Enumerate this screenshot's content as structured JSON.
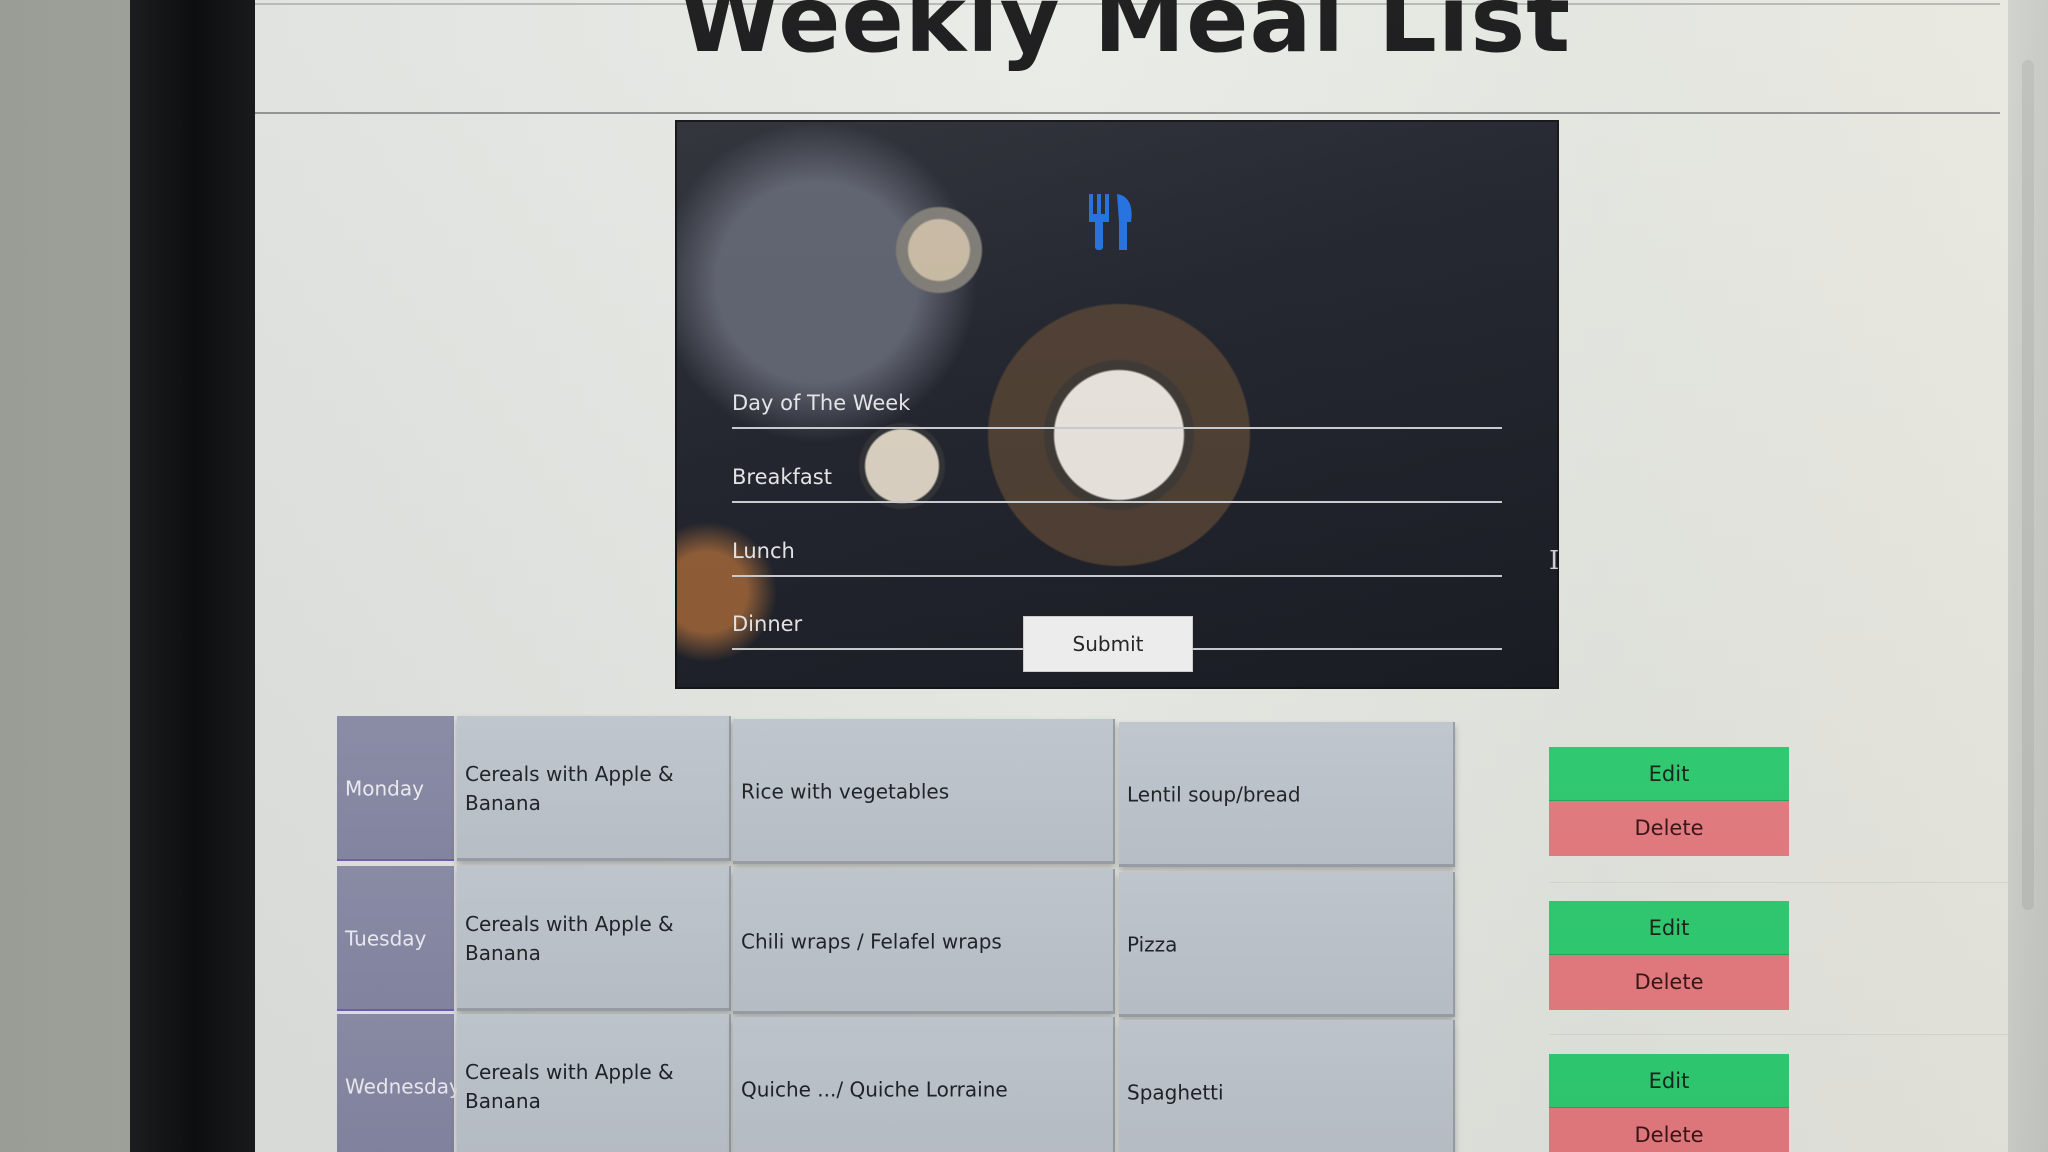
{
  "page": {
    "title": "Weekly Meal List"
  },
  "form": {
    "fields": [
      {
        "placeholder": "Day of The Week"
      },
      {
        "placeholder": "Breakfast"
      },
      {
        "placeholder": "Lunch"
      },
      {
        "placeholder": "Dinner"
      }
    ],
    "submit_label": "Submit",
    "icon": "utensils-icon"
  },
  "meals": {
    "rows": [
      {
        "day": "Monday",
        "breakfast": "Cereals with Apple & Banana",
        "lunch": "Rice with vegetables",
        "dinner": "Lentil soup/bread",
        "edit_label": "Edit",
        "delete_label": "Delete"
      },
      {
        "day": "Tuesday",
        "breakfast": "Cereals with Apple & Banana",
        "lunch": "Chili wraps / Felafel wraps",
        "dinner": "Pizza",
        "edit_label": "Edit",
        "delete_label": "Delete"
      },
      {
        "day": "Wednesday",
        "breakfast": "Cereals with Apple & Banana",
        "lunch": "Quiche .../ Quiche Lorraine",
        "dinner": "Spaghetti",
        "edit_label": "Edit",
        "delete_label": "Delete"
      }
    ]
  },
  "colors": {
    "edit": "#2ecc71",
    "delete": "#e57b80",
    "day_cell": "#8c8ea9",
    "meal_cell": "#c4cad2",
    "icon": "#1e6fe0"
  }
}
